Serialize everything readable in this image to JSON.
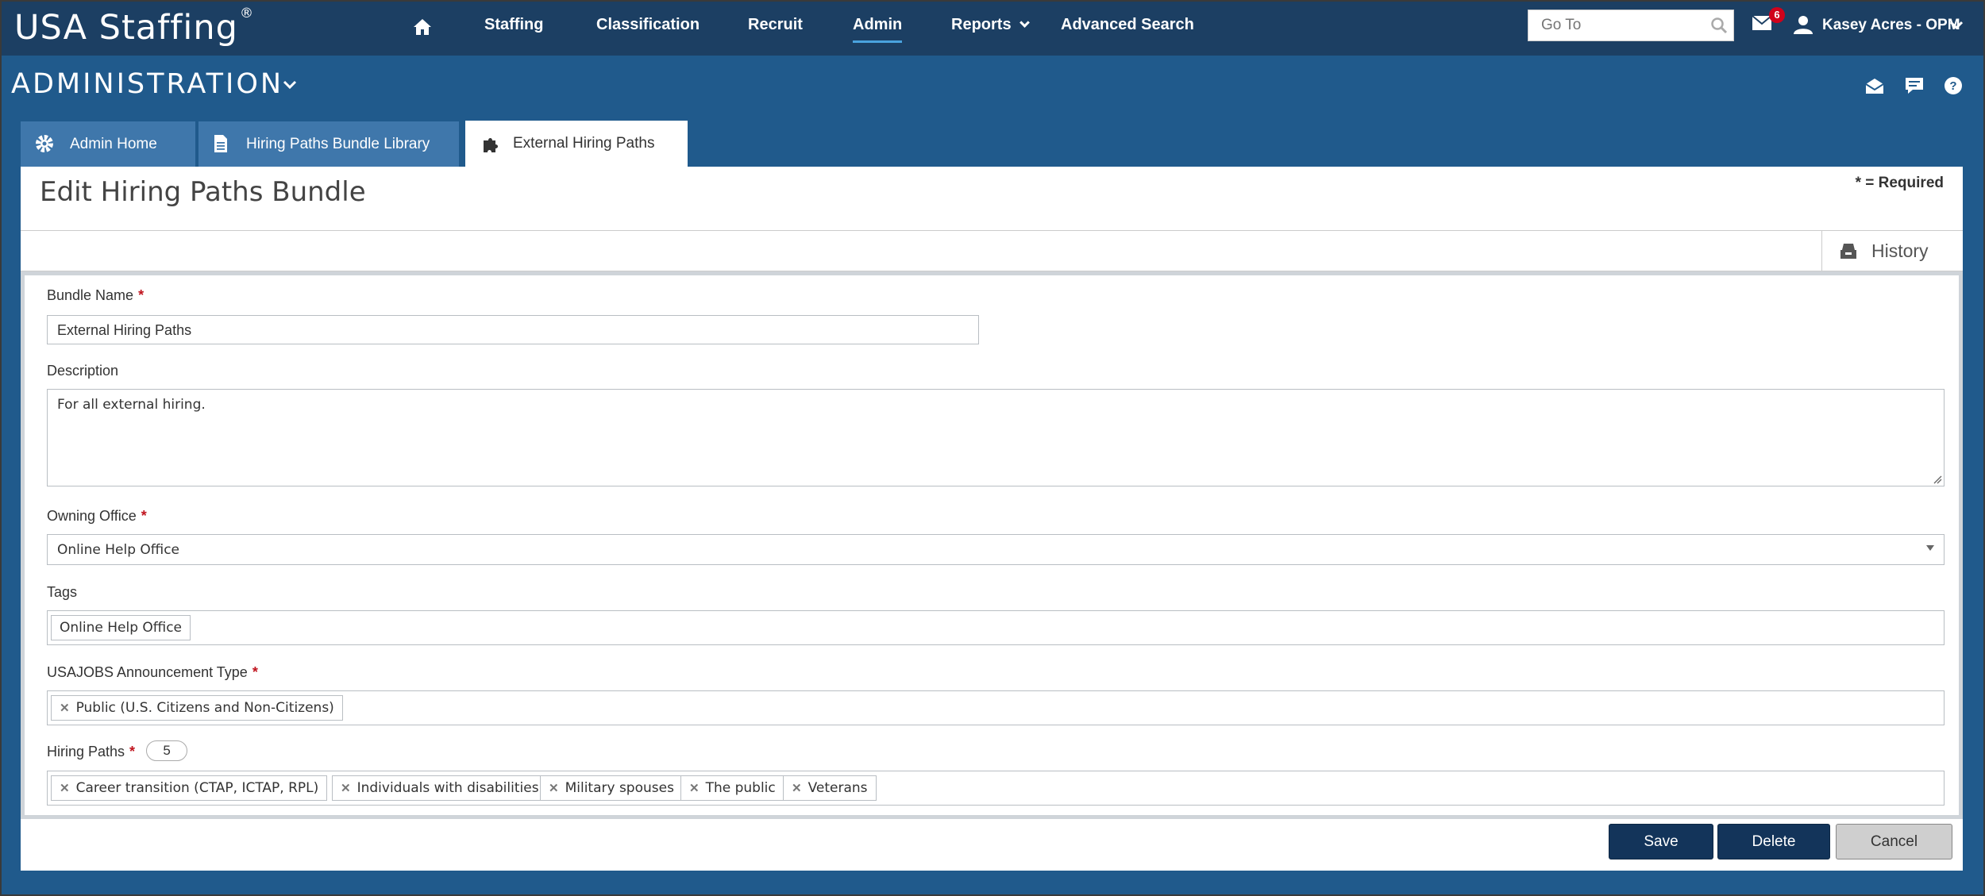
{
  "app": {
    "logo_text": "USA Staffing",
    "logo_mark": "®"
  },
  "nav": {
    "items": [
      {
        "label": "Staffing"
      },
      {
        "label": "Classification"
      },
      {
        "label": "Recruit"
      },
      {
        "label": "Admin",
        "active": true
      },
      {
        "label": "Reports",
        "has_dropdown": true
      },
      {
        "label": "Advanced Search"
      }
    ],
    "goto_placeholder": "Go To",
    "mail_count": "6",
    "user_name": "Kasey Acres - OPM"
  },
  "section": {
    "title": "ADMINISTRATION"
  },
  "tabs": [
    {
      "label": "Admin Home",
      "icon": "gear-icon"
    },
    {
      "label": "Hiring Paths Bundle Library",
      "icon": "document-icon"
    },
    {
      "label": "External Hiring Paths",
      "icon": "puzzle-icon",
      "active": true
    }
  ],
  "page": {
    "title": "Edit Hiring Paths Bundle",
    "required_note": "* = Required",
    "history_label": "History"
  },
  "form": {
    "bundle_name": {
      "label": "Bundle Name",
      "required_mark": "*",
      "value": "External Hiring Paths"
    },
    "description": {
      "label": "Description",
      "value": "For all external hiring."
    },
    "owning_office": {
      "label": "Owning Office",
      "required_mark": "*",
      "value": "Online Help Office"
    },
    "tags": {
      "label": "Tags",
      "items": [
        "Online Help Office"
      ]
    },
    "announcement_type": {
      "label": "USAJOBS Announcement Type",
      "required_mark": "*",
      "items": [
        "Public (U.S. Citizens and Non-Citizens)"
      ]
    },
    "hiring_paths": {
      "label": "Hiring Paths",
      "required_mark": "*",
      "count": "5",
      "items": [
        "Career transition (CTAP, ICTAP, RPL)",
        "Individuals with disabilities",
        "Military spouses",
        "The public",
        "Veterans"
      ]
    }
  },
  "actions": {
    "save_label": "Save",
    "delete_label": "Delete",
    "cancel_label": "Cancel"
  },
  "colors": {
    "top_bar": "#1c3f63",
    "page_background": "#205a8c",
    "tab_inactive": "#3f77ab",
    "primary_button": "#13345a",
    "required_red": "#c0141e",
    "badge_red": "#d0021b"
  }
}
